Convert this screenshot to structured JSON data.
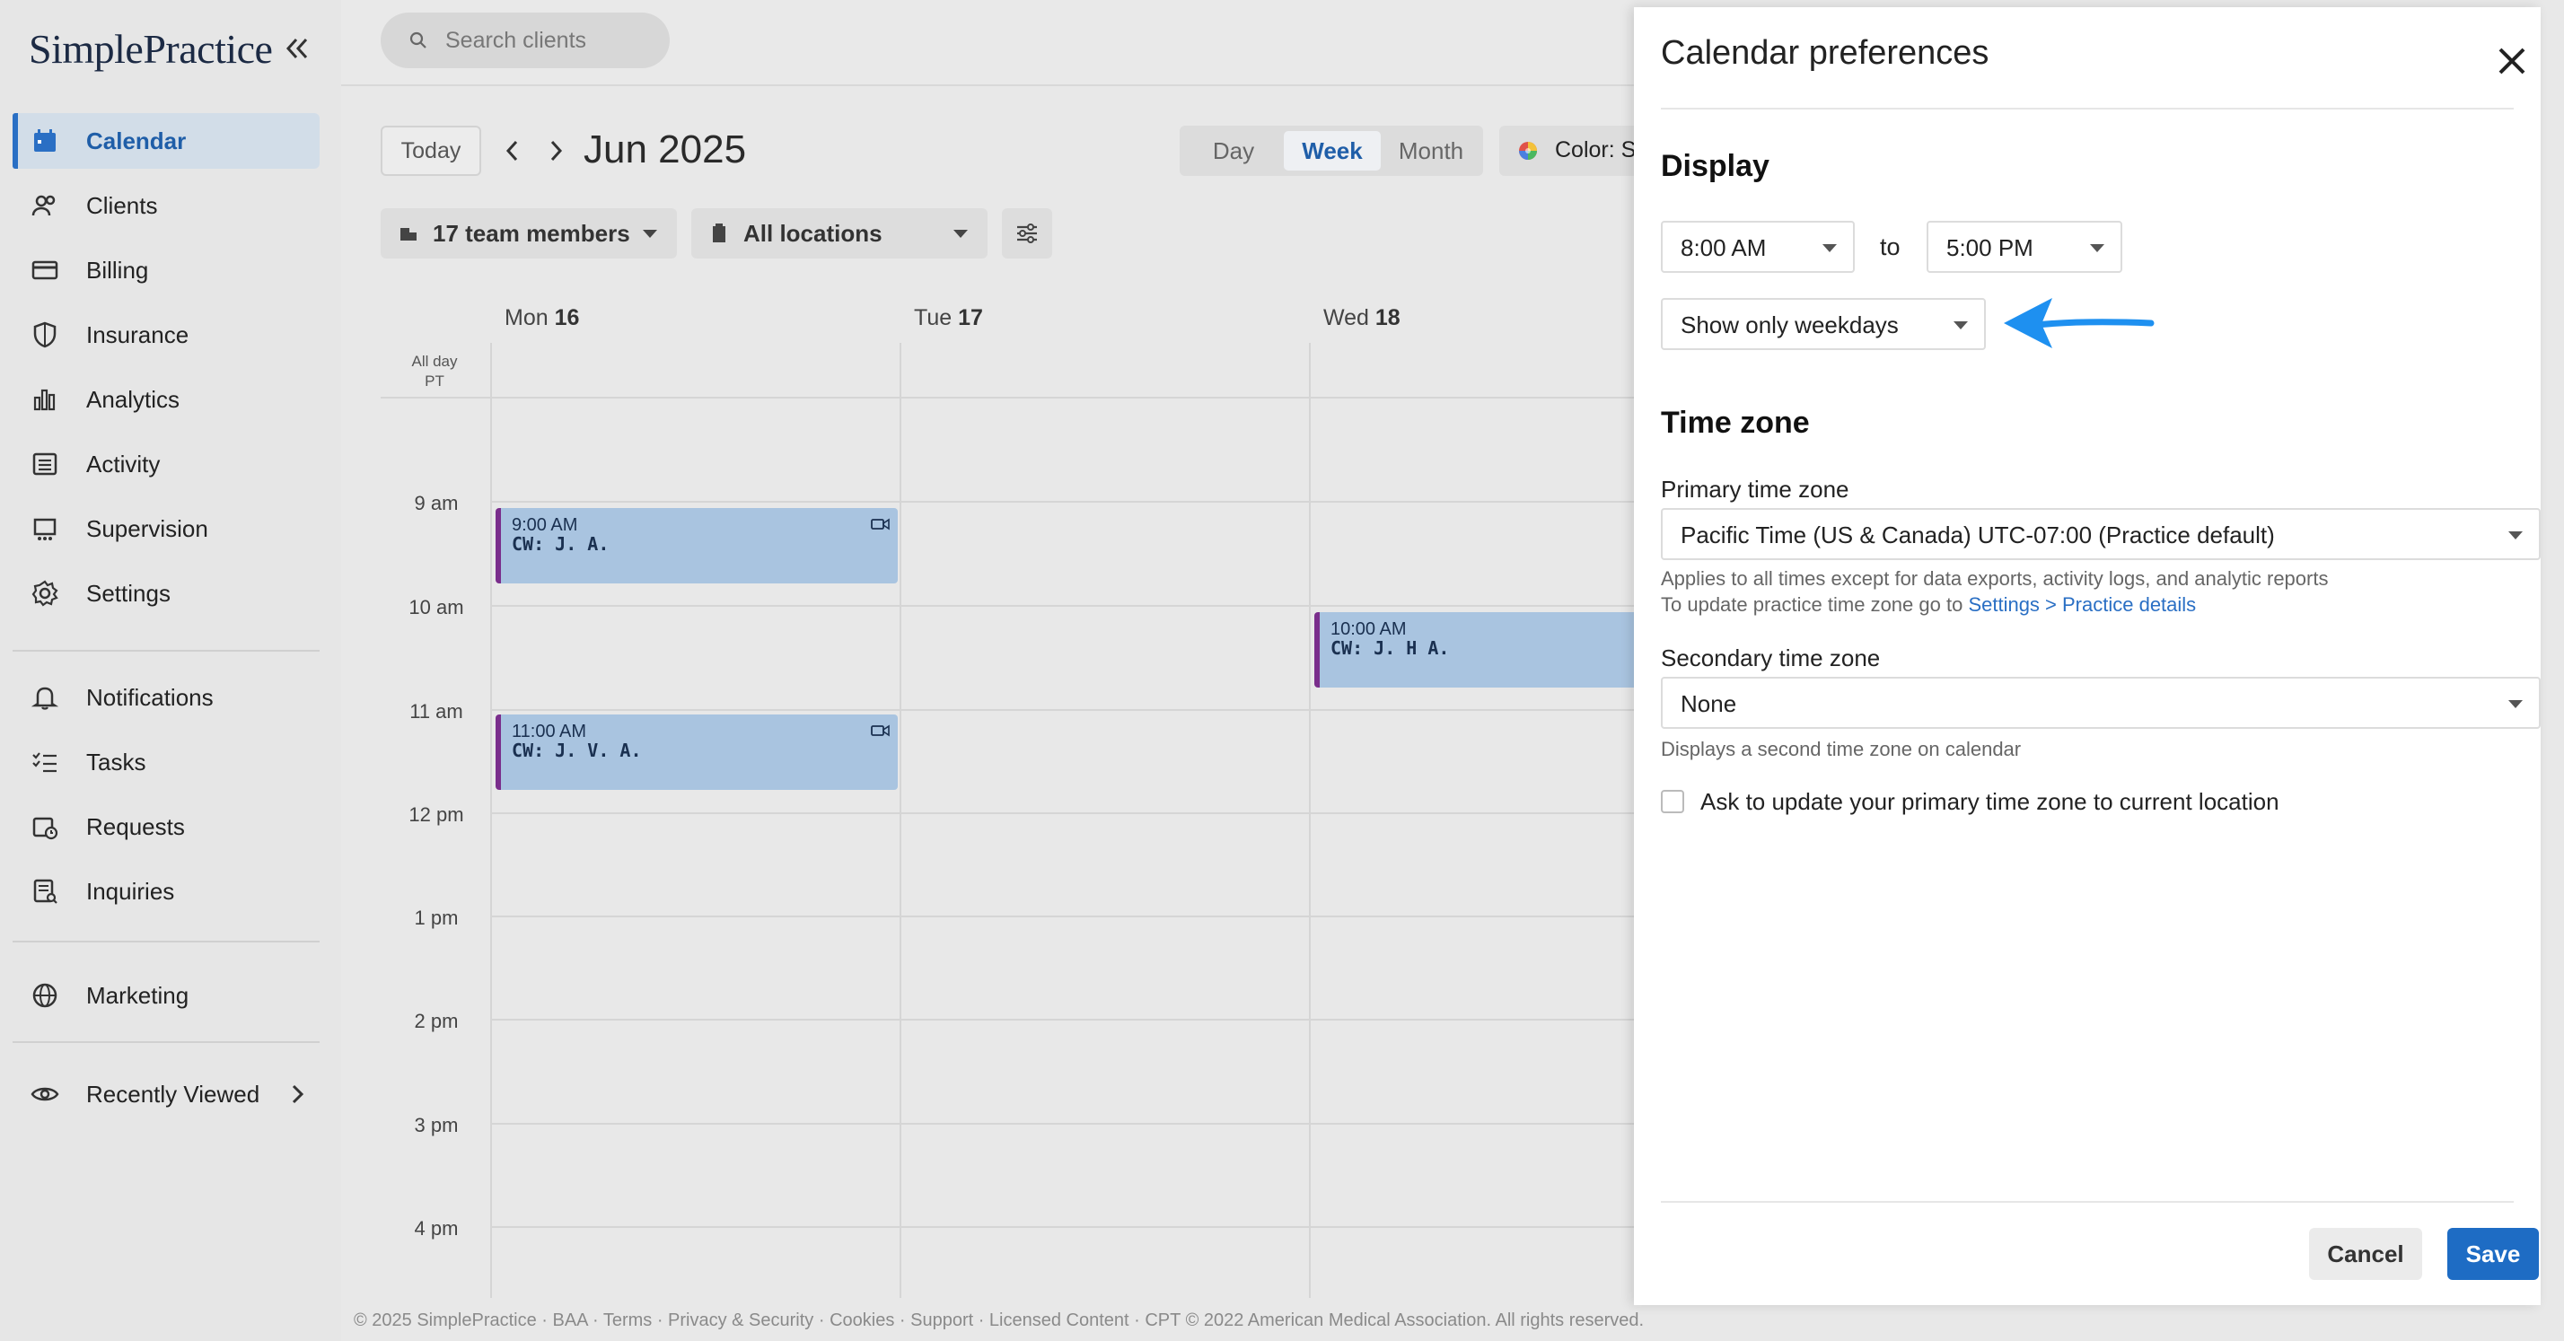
{
  "app": {
    "logo": "SimplePractice"
  },
  "sidebar": {
    "items": [
      {
        "label": "Calendar",
        "icon": "calendar-icon"
      },
      {
        "label": "Clients",
        "icon": "clients-icon"
      },
      {
        "label": "Billing",
        "icon": "billing-icon"
      },
      {
        "label": "Insurance",
        "icon": "shield-icon"
      },
      {
        "label": "Analytics",
        "icon": "chart-icon"
      },
      {
        "label": "Activity",
        "icon": "list-icon"
      },
      {
        "label": "Supervision",
        "icon": "supervision-icon"
      },
      {
        "label": "Settings",
        "icon": "gear-icon"
      },
      {
        "label": "Notifications",
        "icon": "bell-icon"
      },
      {
        "label": "Tasks",
        "icon": "tasks-icon"
      },
      {
        "label": "Requests",
        "icon": "requests-icon"
      },
      {
        "label": "Inquiries",
        "icon": "inquiries-icon"
      },
      {
        "label": "Marketing",
        "icon": "globe-icon"
      },
      {
        "label": "Recently Viewed",
        "icon": "eye-icon"
      }
    ]
  },
  "search": {
    "placeholder": "Search clients"
  },
  "calendar": {
    "today_label": "Today",
    "period": "Jun 2025",
    "views": [
      "Day",
      "Week",
      "Month"
    ],
    "active_view": "Week",
    "color_label": "Color: S",
    "team_filter": "17 team members",
    "location_filter": "All locations",
    "allday_label": "All day",
    "tz_label": "PT",
    "days": [
      {
        "name": "Mon",
        "num": "16"
      },
      {
        "name": "Tue",
        "num": "17"
      },
      {
        "name": "Wed",
        "num": "18"
      }
    ],
    "hours": [
      "9 am",
      "10 am",
      "11 am",
      "12 pm",
      "1 pm",
      "2 pm",
      "3 pm",
      "4 pm"
    ],
    "events": [
      {
        "time": "9:00 AM",
        "name": "CW: J. A.",
        "video": true
      },
      {
        "time": "11:00 AM",
        "name": "CW: J. V. A.",
        "video": true
      },
      {
        "time": "10:00 AM",
        "name": "CW: J. H A.",
        "video": false
      }
    ]
  },
  "footer": "© 2025 SimplePractice · BAA · Terms · Privacy & Security · Cookies · Support · Licensed Content · CPT © 2022 American Medical Association. All rights reserved.",
  "panel": {
    "title": "Calendar preferences",
    "display_heading": "Display",
    "start_time": "8:00 AM",
    "to_label": "to",
    "end_time": "5:00 PM",
    "days_option": "Show only weekdays",
    "timezone_heading": "Time zone",
    "primary_label": "Primary time zone",
    "primary_value": "Pacific Time (US & Canada) UTC-07:00 (Practice default)",
    "primary_hint": "Applies to all times except for data exports, activity logs, and analytic reports",
    "primary_hint2": "To update practice time zone go to ",
    "primary_link": "Settings > Practice details",
    "secondary_label": "Secondary time zone",
    "secondary_value": "None",
    "secondary_hint": "Displays a second time zone on calendar",
    "checkbox_label": "Ask to update your primary time zone to current location",
    "cancel": "Cancel",
    "save": "Save"
  },
  "colors": {
    "accent": "#2a6fc4",
    "event_bg": "#a9c4e0",
    "event_border": "#7a2e8c",
    "arrow": "#1e90f0"
  }
}
